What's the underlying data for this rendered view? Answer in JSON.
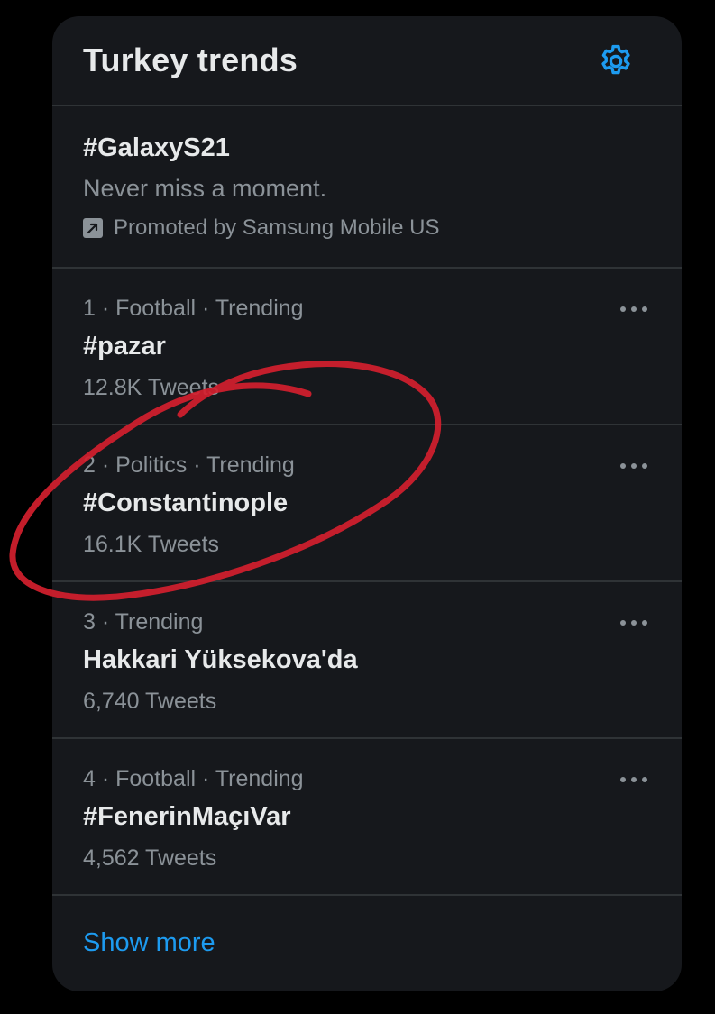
{
  "header": {
    "title": "Turkey trends",
    "settings_icon": "gear-icon"
  },
  "promoted": {
    "hashtag": "#GalaxyS21",
    "description": "Never miss a moment.",
    "promoted_by": "Promoted by Samsung Mobile US",
    "icon": "promoted-arrow-icon"
  },
  "trends": [
    {
      "meta": "1 · Football · Trending",
      "name": "#pazar",
      "count": "12.8K Tweets"
    },
    {
      "meta": "2 · Politics · Trending",
      "name": "#Constantinople",
      "count": "16.1K Tweets"
    },
    {
      "meta": "3 · Trending",
      "name": "Hakkari Yüksekova'da",
      "count": "6,740 Tweets"
    },
    {
      "meta": "4 · Football · Trending",
      "name": "#FenerinMaçıVar",
      "count": "4,562 Tweets"
    }
  ],
  "footer": {
    "show_more": "Show more"
  },
  "colors": {
    "background": "#000000",
    "card": "#16181c",
    "divider": "#2f3336",
    "primary_text": "#e7e9ea",
    "secondary_text": "#8b9298",
    "accent": "#1d9bf0",
    "annotation": "#d41f2e"
  }
}
